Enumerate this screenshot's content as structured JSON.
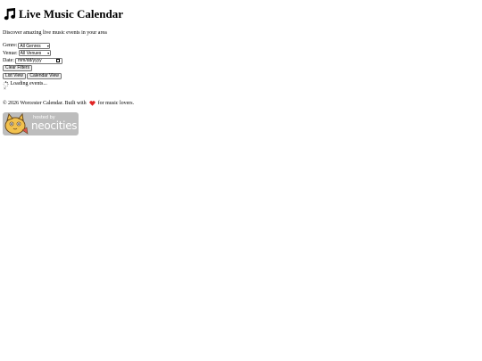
{
  "header": {
    "title": "Live Music Calendar",
    "icon": "music-note-icon"
  },
  "subtitle": "Discover amazing live music events in your area",
  "filters": {
    "genre": {
      "label": "Genre:",
      "selected": "All Genres"
    },
    "venue": {
      "label": "Venue:",
      "selected": "All Venues"
    },
    "date": {
      "label": "Date:",
      "value": "mm/dd/yyyy"
    },
    "clear_label": "Clear Filters"
  },
  "views": {
    "list_label": "List View",
    "calendar_label": "Calendar View"
  },
  "loading": {
    "text": "Loading events...",
    "icon": "spinner-icon"
  },
  "close_glyph": "×",
  "footer": {
    "before_heart": "© 2026 Worcester Calendar. Built with ",
    "after_heart": " for music lovers.",
    "heart_color": "#e02424"
  },
  "badge": {
    "hosted_by": "hosted by",
    "name": "neocities",
    "background": "#bdbdbd"
  }
}
